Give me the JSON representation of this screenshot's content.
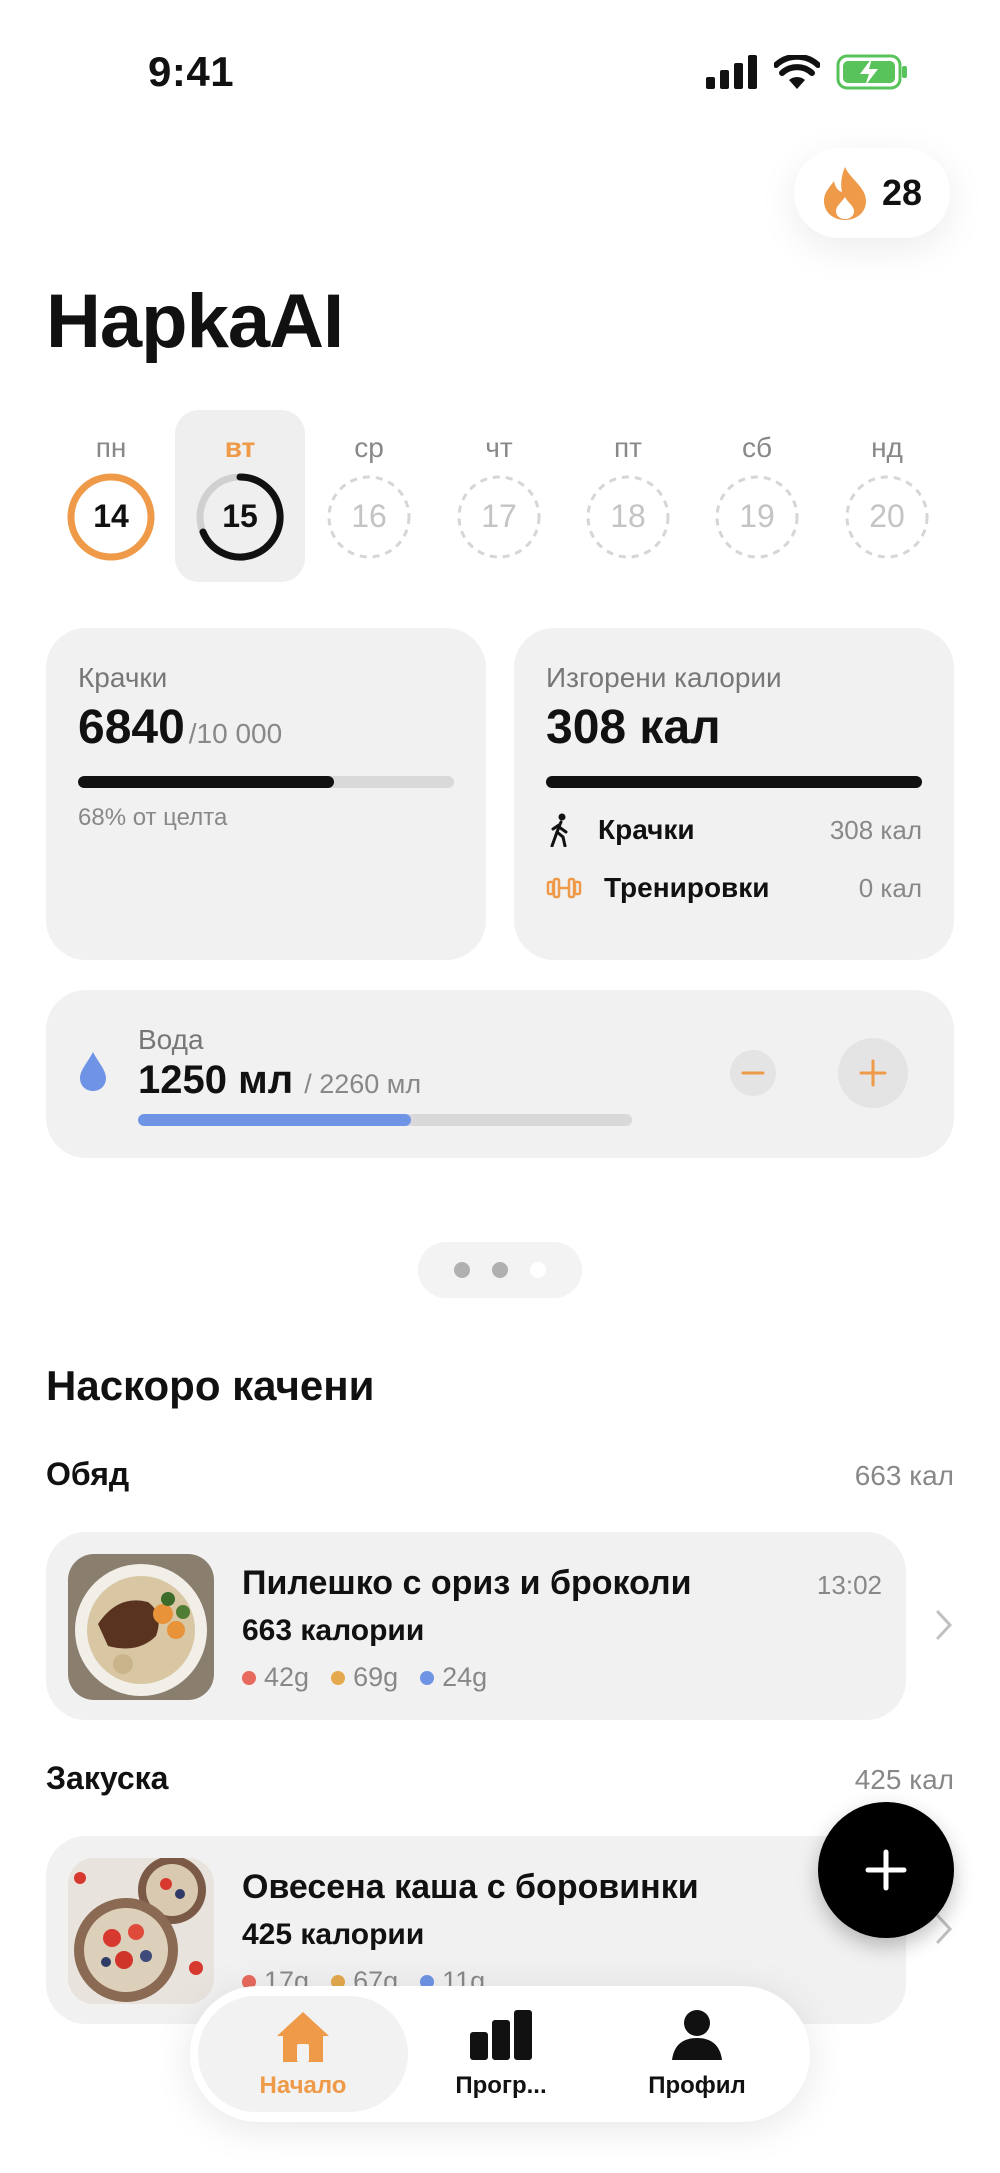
{
  "status_bar": {
    "time": "9:41"
  },
  "streak": {
    "count": "28"
  },
  "app": {
    "title": "HapkaAI"
  },
  "week": [
    {
      "label": "пн",
      "num": "14",
      "state": "complete"
    },
    {
      "label": "вт",
      "num": "15",
      "state": "selected"
    },
    {
      "label": "ср",
      "num": "16",
      "state": "future"
    },
    {
      "label": "чт",
      "num": "17",
      "state": "future"
    },
    {
      "label": "пт",
      "num": "18",
      "state": "future"
    },
    {
      "label": "сб",
      "num": "19",
      "state": "future"
    },
    {
      "label": "нд",
      "num": "20",
      "state": "future"
    }
  ],
  "steps": {
    "title": "Крачки",
    "value": "6840",
    "goal": "/10 000",
    "progress": 0.68,
    "percent_text": "68% от целта"
  },
  "calories": {
    "title": "Изгорени калории",
    "value": "308 кал",
    "rows": [
      {
        "label": "Крачки",
        "value": "308 кал",
        "icon": "walking-icon"
      },
      {
        "label": "Тренировки",
        "value": "0 кал",
        "icon": "dumbbell-icon"
      }
    ]
  },
  "water": {
    "title": "Вода",
    "value": "1250 мл",
    "goal": "/ 2260 мл",
    "progress": 0.553
  },
  "recent": {
    "title": "Наскоро качени",
    "groups": [
      {
        "name": "Обяд",
        "kcal": "663 кал",
        "meal": {
          "name": "Пилешко с ориз и броколи",
          "time": "13:02",
          "kcal": "663 калории",
          "macros": [
            "42g",
            "69g",
            "24g"
          ]
        }
      },
      {
        "name": "Закуска",
        "kcal": "425 кал",
        "meal": {
          "name": "Овесена каша с боровинки",
          "time": "",
          "kcal": "425 калории",
          "macros": [
            "17g",
            "67g",
            "11g"
          ]
        }
      }
    ]
  },
  "tabs": [
    {
      "label": "Начало",
      "icon": "home-icon"
    },
    {
      "label": "Прогр...",
      "icon": "progress-chart-icon"
    },
    {
      "label": "Профил",
      "icon": "profile-icon"
    }
  ],
  "colors": {
    "accent": "#ee9a48",
    "water": "#6f94e6",
    "protein": "#e86a5e",
    "carbs": "#e5a94d",
    "fat": "#6f94e6"
  }
}
